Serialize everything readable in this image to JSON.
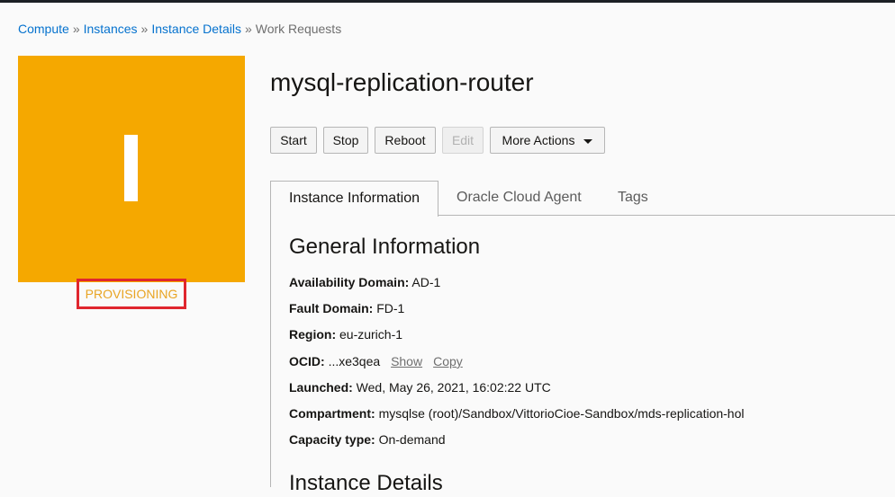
{
  "breadcrumb": {
    "items": [
      "Compute",
      "Instances",
      "Instance Details"
    ],
    "separator": "»",
    "current": "Work Requests"
  },
  "instance": {
    "tile_letter": "I",
    "tile_color": "#f5a800",
    "status": "PROVISIONING",
    "status_color": "#e8a423",
    "name": "mysql-replication-router"
  },
  "actions": {
    "start": "Start",
    "stop": "Stop",
    "reboot": "Reboot",
    "edit": "Edit",
    "more": "More Actions"
  },
  "tabs": [
    "Instance Information",
    "Oracle Cloud Agent",
    "Tags"
  ],
  "general": {
    "title": "General Information",
    "availability_domain": {
      "label": "Availability Domain:",
      "value": "AD-1"
    },
    "fault_domain": {
      "label": "Fault Domain:",
      "value": "FD-1"
    },
    "region": {
      "label": "Region:",
      "value": "eu-zurich-1"
    },
    "ocid": {
      "label": "OCID:",
      "value": "...xe3qea",
      "show": "Show",
      "copy": "Copy"
    },
    "launched": {
      "label": "Launched:",
      "value": "Wed, May 26, 2021, 16:02:22 UTC"
    },
    "compartment": {
      "label": "Compartment:",
      "value": "mysqlse (root)/Sandbox/VittorioCioe-Sandbox/mds-replication-hol"
    },
    "capacity_type": {
      "label": "Capacity type:",
      "value": "On-demand"
    }
  },
  "details": {
    "title": "Instance Details"
  }
}
